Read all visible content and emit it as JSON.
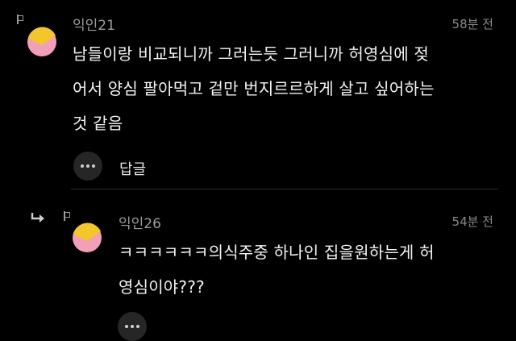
{
  "comments": [
    {
      "username": "익인21",
      "time": "58분 전",
      "lines": [
        "남들이랑 비교되니까 그러는듯 그러니까 허영심에 젖",
        "어서 양심 팔아먹고 겉만 번지르르하게 살고 싶어하는",
        "것 같음"
      ],
      "reply_label": "답글"
    },
    {
      "username": "익인26",
      "time": "54분 전",
      "lines": [
        "ㅋㅋㅋㅋㅋㅋ의식주중 하나인 집을원하는게 허",
        "영심이야???"
      ]
    }
  ],
  "icons": {
    "flag": "flag-icon",
    "avatar": "avatar-icon",
    "more": "more-options-icon",
    "reply_arrow": "reply-arrow-icon"
  },
  "colors": {
    "background": "#000000",
    "avatar_yellow": "#f3c62c",
    "avatar_pink": "#f2a0b8",
    "muted_text": "#9c9c9c"
  }
}
